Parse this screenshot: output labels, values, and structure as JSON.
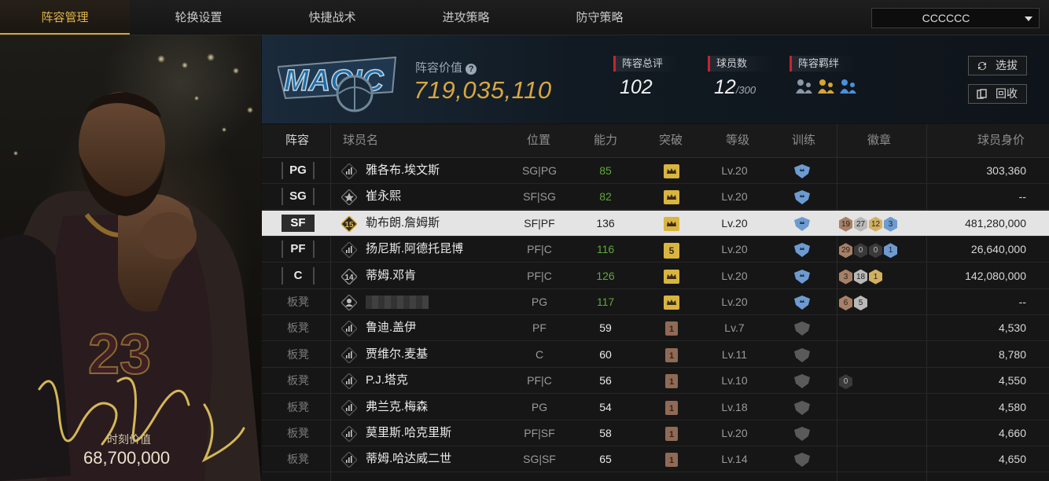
{
  "tabs": [
    {
      "label": "阵容管理",
      "active": true
    },
    {
      "label": "轮换设置",
      "active": false
    },
    {
      "label": "快捷战术",
      "active": false
    },
    {
      "label": "进攻策略",
      "active": false
    },
    {
      "label": "防守策略",
      "active": false
    }
  ],
  "team_select": {
    "value": "CCCCCC"
  },
  "featured_player": {
    "number": "23",
    "moment_label": "时刻价值",
    "moment_value": "68,700,000"
  },
  "team": {
    "logo_text": "MAGIC",
    "value_label": "阵容价值",
    "value": "719,035,110",
    "rating_label": "阵容总评",
    "rating": "102",
    "count_label": "球员数",
    "count": "12",
    "count_max": "/300",
    "synergy_label": "阵容羁绊"
  },
  "buttons": {
    "pick": "选拔",
    "recycle": "回收"
  },
  "columns": {
    "lineup": "阵容",
    "name": "球员名",
    "position": "位置",
    "ability": "能力",
    "breakthrough": "突破",
    "level": "等级",
    "training": "训练",
    "badges": "徽章",
    "value": "球员身价"
  },
  "players": [
    {
      "slot": "PG",
      "name": "雅各布.埃文斯",
      "pos": "SG|PG",
      "ability": "85",
      "break": "gold",
      "level": "Lv.20",
      "train": "blue",
      "badges": [],
      "value": "303,360"
    },
    {
      "slot": "SG",
      "name": "崔永熙",
      "pos": "SF|SG",
      "ability": "82",
      "break": "gold",
      "level": "Lv.20",
      "train": "blue",
      "badges": [],
      "value": "--"
    },
    {
      "slot": "SF",
      "name": "勒布朗.詹姆斯",
      "pos": "SF|PF",
      "ability": "136",
      "break": "gold",
      "level": "Lv.20",
      "train": "blue",
      "badges": [
        "19",
        "27",
        "12",
        "3"
      ],
      "value": "481,280,000",
      "selected": true,
      "jersey": "15"
    },
    {
      "slot": "PF",
      "name": "扬尼斯.阿德托昆博",
      "pos": "PF|C",
      "ability": "116",
      "break": "gold5",
      "level": "Lv.20",
      "train": "blue",
      "badges": [
        "29",
        "0",
        "0",
        "1"
      ],
      "value": "26,640,000"
    },
    {
      "slot": "C",
      "name": "蒂姆.邓肯",
      "pos": "PF|C",
      "ability": "126",
      "break": "gold",
      "level": "Lv.20",
      "train": "blue",
      "badges": [
        "3",
        "18",
        "1"
      ],
      "value": "142,080,000",
      "jersey": "14"
    },
    {
      "slot": "板凳",
      "name": "",
      "pos": "PG",
      "ability": "117",
      "break": "gold",
      "level": "Lv.20",
      "train": "blue",
      "badges": [
        "6",
        "5"
      ],
      "value": "--",
      "blurred": true
    },
    {
      "slot": "板凳",
      "name": "鲁迪.盖伊",
      "pos": "PF",
      "ability": "59",
      "break": "bronze",
      "level": "Lv.7",
      "train": "gray",
      "badges": [],
      "value": "4,530"
    },
    {
      "slot": "板凳",
      "name": "贾维尔.麦基",
      "pos": "C",
      "ability": "60",
      "break": "bronze",
      "level": "Lv.11",
      "train": "gray",
      "badges": [],
      "value": "8,780"
    },
    {
      "slot": "板凳",
      "name": "P.J.塔克",
      "pos": "PF|C",
      "ability": "56",
      "break": "bronze",
      "level": "Lv.10",
      "train": "gray",
      "badges": [
        "0"
      ],
      "value": "4,550"
    },
    {
      "slot": "板凳",
      "name": "弗兰克.梅森",
      "pos": "PG",
      "ability": "54",
      "break": "bronze",
      "level": "Lv.18",
      "train": "gray",
      "badges": [],
      "value": "4,580"
    },
    {
      "slot": "板凳",
      "name": "莫里斯.哈克里斯",
      "pos": "PF|SF",
      "ability": "58",
      "break": "bronze",
      "level": "Lv.20",
      "train": "gray",
      "badges": [],
      "value": "4,660"
    },
    {
      "slot": "板凳",
      "name": "蒂姆.哈达威二世",
      "pos": "SG|SF",
      "ability": "65",
      "break": "bronze",
      "level": "Lv.14",
      "train": "gray",
      "badges": [],
      "value": "4,650"
    }
  ],
  "colors": {
    "accent": "#d5a631",
    "ability_green": "#5fa83a",
    "ability_white": "#eaeaea"
  }
}
